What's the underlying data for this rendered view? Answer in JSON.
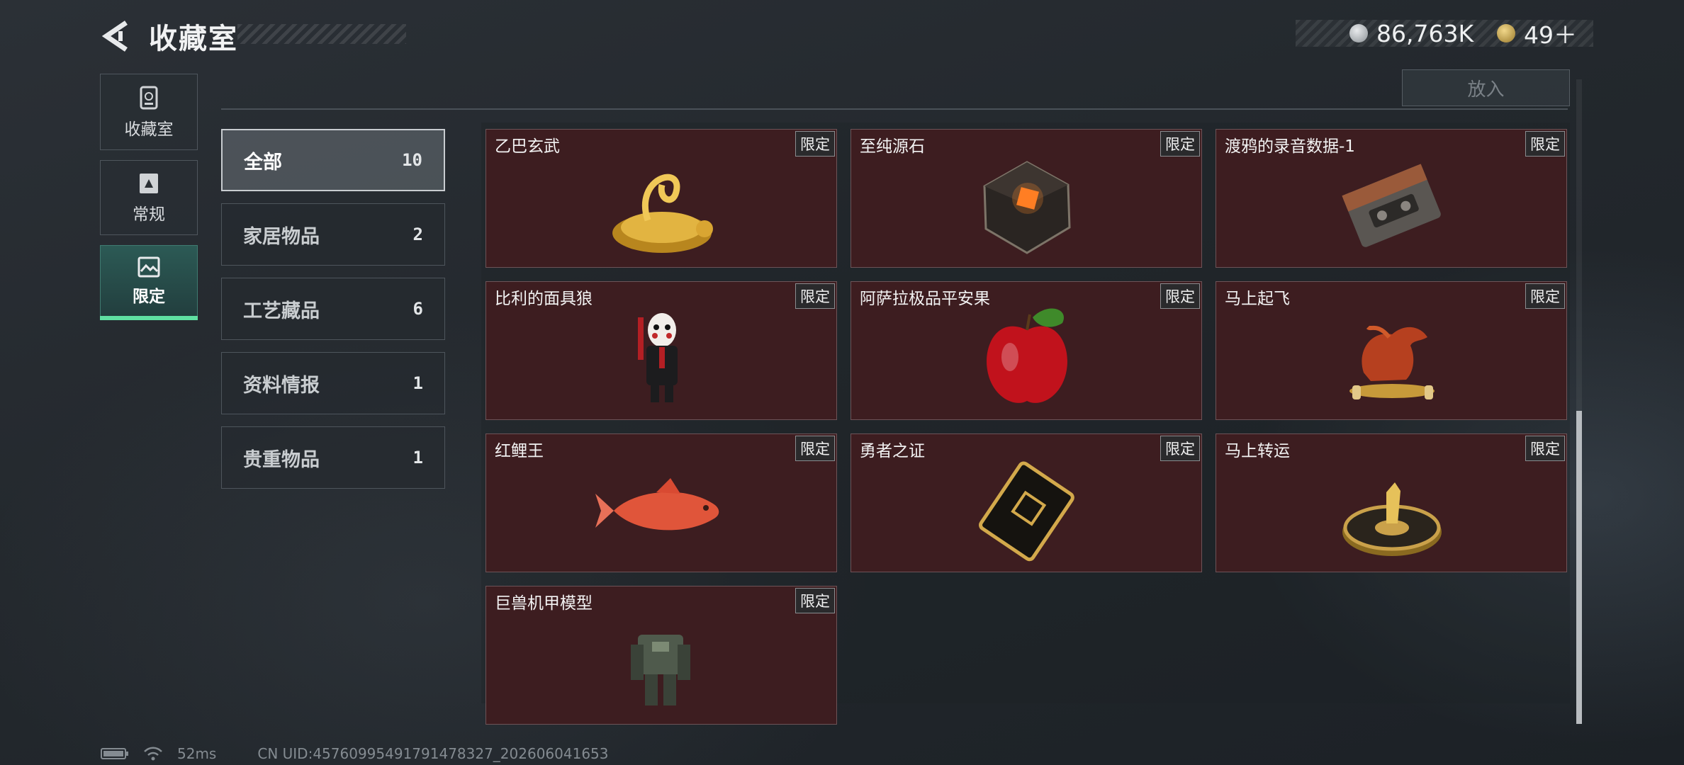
{
  "header": {
    "title": "收藏室",
    "currency": [
      {
        "icon": "silver-coin-icon",
        "value": "86,763K"
      },
      {
        "icon": "gold-token-icon",
        "value": "49＋"
      }
    ]
  },
  "sidebar": [
    {
      "label": "收藏室",
      "icon": "collection-room-icon"
    },
    {
      "label": "常规",
      "icon": "regular-book-icon"
    },
    {
      "label": "限定",
      "icon": "limited-image-icon",
      "active": true
    }
  ],
  "top_button": "放入",
  "categories": [
    {
      "name": "全部",
      "count": "10",
      "active": true
    },
    {
      "name": "家居物品",
      "count": "2"
    },
    {
      "name": "工艺藏品",
      "count": "6"
    },
    {
      "name": "资料情报",
      "count": "1"
    },
    {
      "name": "贵重物品",
      "count": "1"
    }
  ],
  "items": [
    {
      "name": "乙巴玄武",
      "tag": "限定",
      "icon": "golden-tortoise-snake-icon"
    },
    {
      "name": "至纯源石",
      "tag": "限定",
      "icon": "crystal-stone-icon"
    },
    {
      "name": "渡鸦的录音数据-1",
      "tag": "限定",
      "icon": "cassette-tape-icon"
    },
    {
      "name": "比利的面具狼",
      "tag": "限定",
      "icon": "puppet-doll-icon"
    },
    {
      "name": "阿萨拉极品平安果",
      "tag": "限定",
      "icon": "red-apple-icon"
    },
    {
      "name": "马上起飞",
      "tag": "限定",
      "icon": "red-horse-statue-icon"
    },
    {
      "name": "红鲤王",
      "tag": "限定",
      "icon": "red-carp-icon"
    },
    {
      "name": "勇者之证",
      "tag": "限定",
      "icon": "golden-card-icon"
    },
    {
      "name": "马上转运",
      "tag": "限定",
      "icon": "golden-coin-horse-icon"
    },
    {
      "name": "巨兽机甲模型",
      "tag": "限定",
      "icon": "mech-model-icon"
    }
  ],
  "footer": {
    "latency": "52ms",
    "uid": "CN UID:45760995491791478327_202606041653"
  },
  "colors": {
    "card_bg": "#3d1d20",
    "active_accent": "#5fe0a2"
  }
}
